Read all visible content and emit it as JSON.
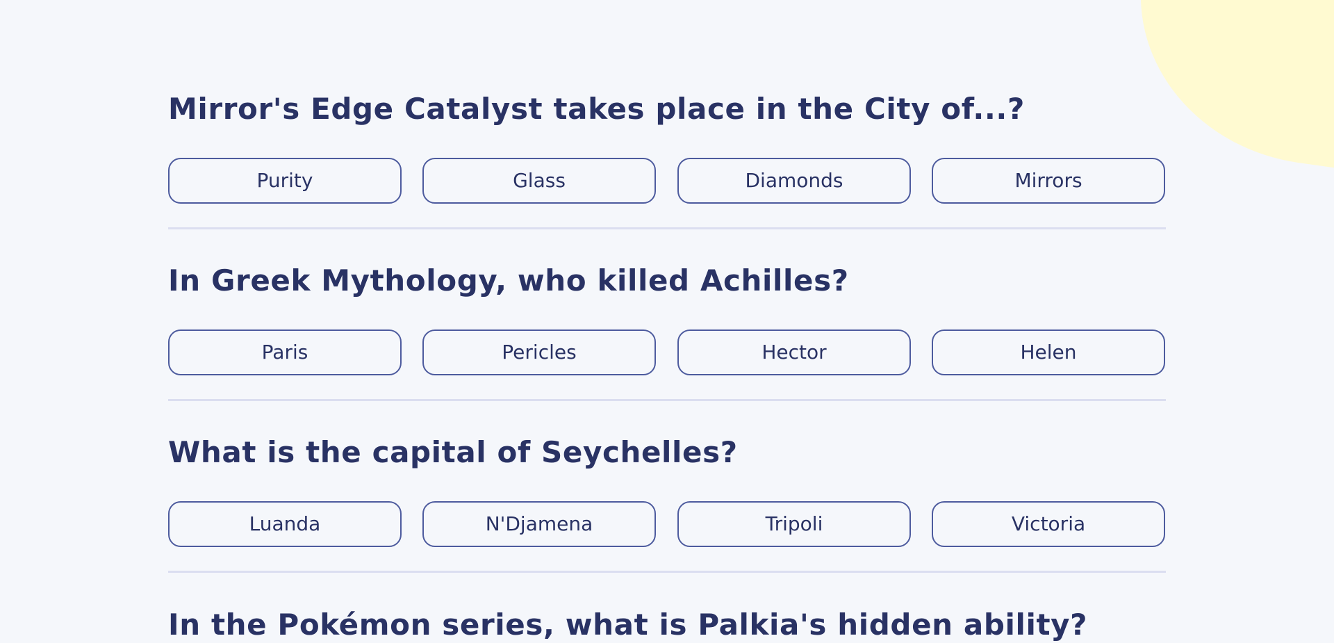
{
  "questions": [
    {
      "question": "Mirror's Edge Catalyst takes place in the City of...?",
      "answers": [
        "Purity",
        "Glass",
        "Diamonds",
        "Mirrors"
      ]
    },
    {
      "question": "In Greek Mythology, who killed Achilles?",
      "answers": [
        "Paris",
        "Pericles",
        "Hector",
        "Helen"
      ]
    },
    {
      "question": "What is the capital of Seychelles?",
      "answers": [
        "Luanda",
        "N'Djamena",
        "Tripoli",
        "Victoria"
      ]
    },
    {
      "question": "In the Pokémon series, what is Palkia's hidden ability?"
    }
  ],
  "colors": {
    "background": "#F5F7FB",
    "text": "#293264",
    "button_border": "#4D5B9E",
    "divider": "#DBDEF0",
    "blob": "#FFFAD1"
  }
}
